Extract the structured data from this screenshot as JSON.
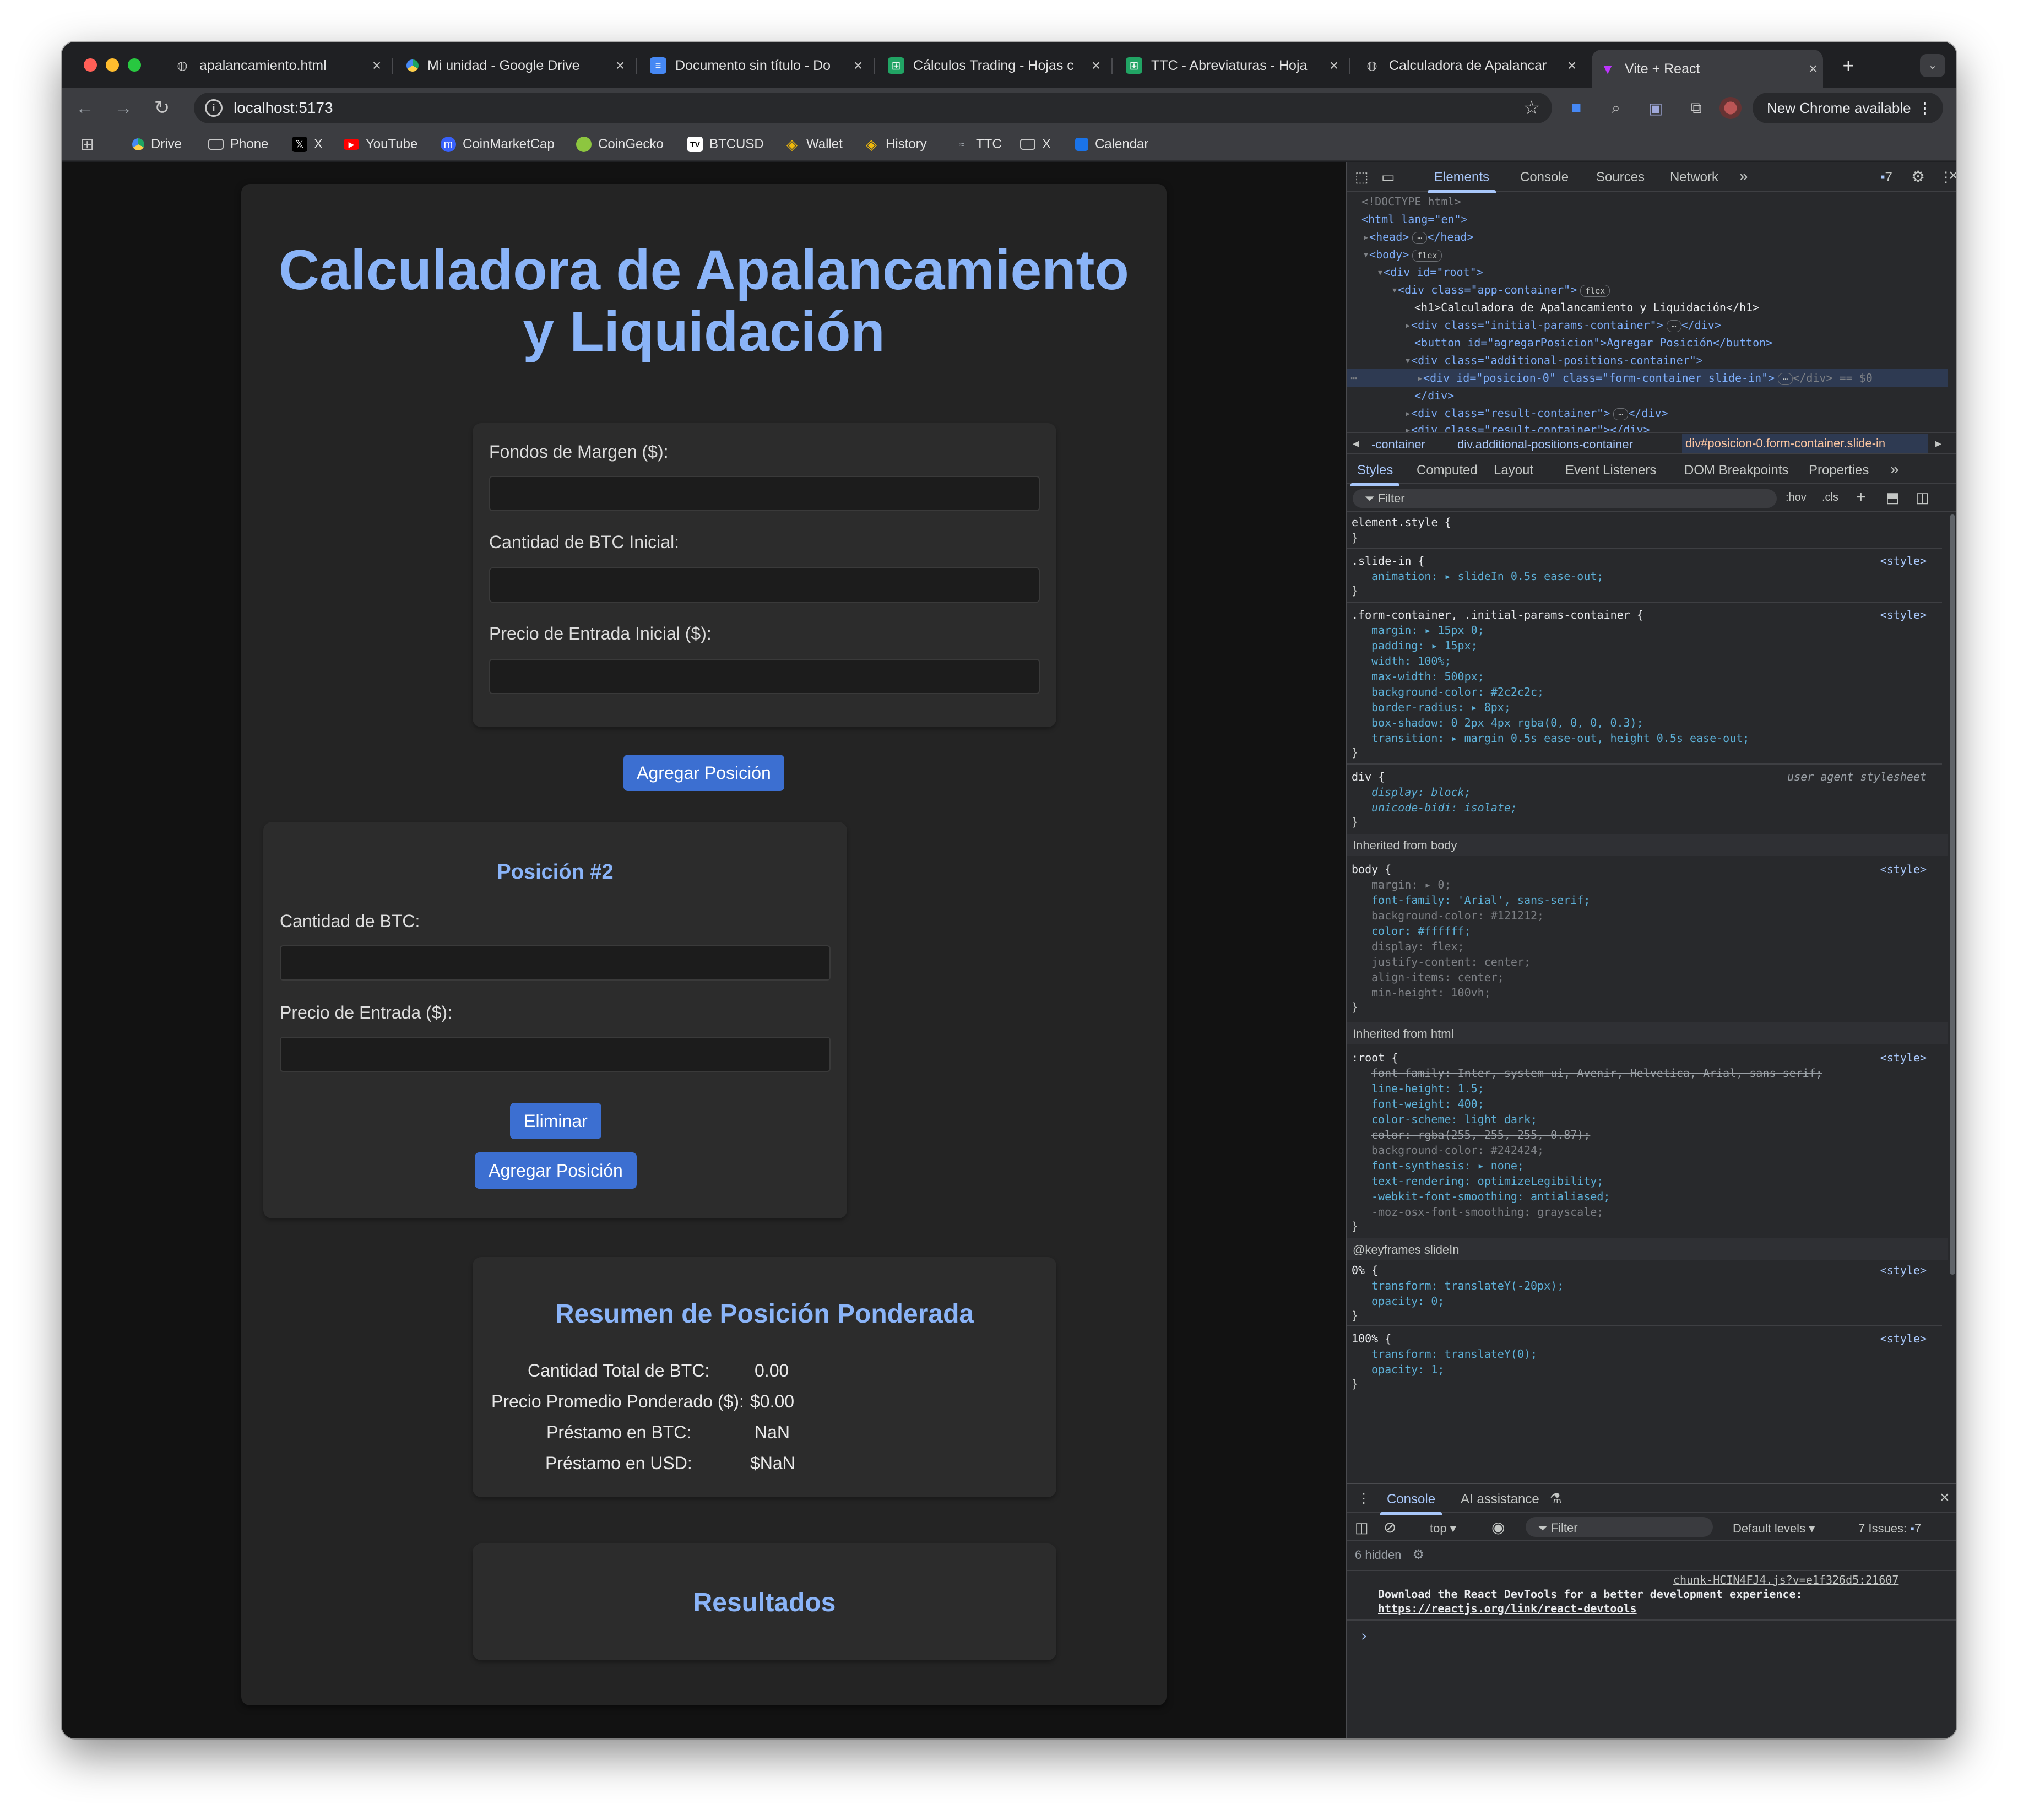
{
  "browser": {
    "tabs": [
      {
        "title": "apalancamiento.html",
        "icon": "globe-icon"
      },
      {
        "title": "Mi unidad - Google Drive",
        "icon": "drive-icon"
      },
      {
        "title": "Documento sin título - Do",
        "icon": "docs-icon"
      },
      {
        "title": "Cálculos Trading - Hojas c",
        "icon": "sheets-icon"
      },
      {
        "title": "TTC - Abreviaturas - Hoja",
        "icon": "sheets-icon"
      },
      {
        "title": "Calculadora de Apalancar",
        "icon": "globe-icon"
      },
      {
        "title": "Vite + React",
        "icon": "vite-icon",
        "active": true
      }
    ],
    "new_tab": "+",
    "url": "localhost:5173",
    "new_chrome": "New Chrome available",
    "bookmarks": [
      {
        "label": "Drive",
        "icon": "drive-icon"
      },
      {
        "label": "Phone",
        "icon": "folder-icon"
      },
      {
        "label": "X",
        "icon": "x-logo-icon"
      },
      {
        "label": "YouTube",
        "icon": "youtube-icon"
      },
      {
        "label": "CoinMarketCap",
        "icon": "coinmarketcap-icon"
      },
      {
        "label": "CoinGecko",
        "icon": "coingecko-icon"
      },
      {
        "label": "BTCUSD",
        "icon": "tradingview-icon"
      },
      {
        "label": "Wallet",
        "icon": "binance-icon"
      },
      {
        "label": "History",
        "icon": "binance-icon"
      },
      {
        "label": "TTC",
        "icon": "ttc-icon"
      },
      {
        "label": "X",
        "icon": "folder-icon"
      },
      {
        "label": "Calendar",
        "icon": "calendar-icon"
      }
    ]
  },
  "app": {
    "title": "Calculadora de Apalancamiento y Liquidación",
    "title_line1": "Calculadora de Apalancamiento",
    "title_line2": "y Liquidación",
    "initial": {
      "margin_label": "Fondos de Margen ($):",
      "btc_label": "Cantidad de BTC Inicial:",
      "price_label": "Precio de Entrada Inicial ($):"
    },
    "add_button": "Agregar Posición",
    "position": {
      "title": "Posición #2",
      "btc_label": "Cantidad de BTC:",
      "price_label": "Precio de Entrada ($):",
      "delete_button": "Eliminar",
      "add_button": "Agregar Posición"
    },
    "summary": {
      "title": "Resumen de Posición Ponderada",
      "rows": [
        {
          "label": "Cantidad Total de BTC:",
          "value": "0.00"
        },
        {
          "label": "Precio Promedio Ponderado ($):",
          "value": "$0.00"
        },
        {
          "label": "Préstamo en BTC:",
          "value": "NaN"
        },
        {
          "label": "Préstamo en USD:",
          "value": "$NaN"
        }
      ]
    },
    "results_title": "Resultados"
  },
  "devtools": {
    "tabs": [
      "Elements",
      "Console",
      "Sources",
      "Network"
    ],
    "issues_count": "7",
    "dom": {
      "doctype": "<!DOCTYPE html>",
      "html_open": "<html lang=\"en\">",
      "head": "<head>",
      "head_close": "</head>",
      "body": "<body>",
      "root": "<div id=\"root\">",
      "app_container": "<div class=\"app-container\">",
      "h1": "<h1>Calculadora de Apalancamiento y Liquidación</h1>",
      "initial_params": "<div class=\"initial-params-container\">",
      "div_close": "</div>",
      "button": "<button id=\"agregarPosicion\">Agregar Posición</button>",
      "additional": "<div class=\"additional-positions-container\">",
      "posicion": "<div id=\"posicion-0\" class=\"form-container slide-in\">",
      "posicion_tail": "</div> == $0",
      "result": "<div class=\"result-container\">",
      "result2": "<div class=\"result-container\"></div>",
      "flex_badge": "flex"
    },
    "breadcrumbs": [
      "-container",
      "div.additional-positions-container",
      "div#posicion-0.form-container.slide-in"
    ],
    "panel_tabs": [
      "Styles",
      "Computed",
      "Layout",
      "Event Listeners",
      "DOM Breakpoints",
      "Properties"
    ],
    "filter_placeholder": "Filter",
    "hov": ":hov",
    "cls": ".cls",
    "styles": {
      "element_style": "element.style {",
      "close": "}",
      "source": "<style>",
      "slide_in_sel": ".slide-in {",
      "slide_in_anim": "animation: ▸ slideIn 0.5s ease-out;",
      "fc_sel": ".form-container, .initial-params-container {",
      "fc_props": [
        "margin: ▸ 15px 0;",
        "padding: ▸ 15px;",
        "width: 100%;",
        "max-width: 500px;",
        "background-color: #2c2c2c;",
        "border-radius: ▸ 8px;",
        "box-shadow: 0 2px 4px rgba(0, 0, 0, 0.3);",
        "transition: ▸ margin 0.5s ease-out, height 0.5s ease-out;"
      ],
      "div_sel": "div {",
      "div_source": "user agent stylesheet",
      "div_props": [
        "display: block;",
        "unicode-bidi: isolate;"
      ],
      "inherited_body": "Inherited from body",
      "body_sel": "body {",
      "body_props": [
        {
          "t": "margin: ▸ 0;",
          "dim": true
        },
        {
          "t": "font-family: 'Arial', sans-serif;",
          "dim": false
        },
        {
          "t": "background-color: #121212;",
          "dim": true
        },
        {
          "t": "color: #ffffff;",
          "dim": false
        },
        {
          "t": "display: flex;",
          "dim": true
        },
        {
          "t": "justify-content: center;",
          "dim": true
        },
        {
          "t": "align-items: center;",
          "dim": true
        },
        {
          "t": "min-height: 100vh;",
          "dim": true
        }
      ],
      "inherited_html": "Inherited from html",
      "root_sel": ":root {",
      "root_props": [
        {
          "t": "font-family: Inter, system-ui, Avenir, Helvetica, Arial, sans-serif;",
          "s": "strike"
        },
        {
          "t": "line-height: 1.5;",
          "s": "normal"
        },
        {
          "t": "font-weight: 400;",
          "s": "normal"
        },
        {
          "t": "color-scheme: light dark;",
          "s": "normal"
        },
        {
          "t": "color: rgba(255, 255, 255, 0.87);",
          "s": "strike"
        },
        {
          "t": "background-color: #242424;",
          "s": "dim"
        },
        {
          "t": "font-synthesis: ▸ none;",
          "s": "normal"
        },
        {
          "t": "text-rendering: optimizeLegibility;",
          "s": "normal"
        },
        {
          "t": "-webkit-font-smoothing: antialiased;",
          "s": "normal"
        },
        {
          "t": "-moz-osx-font-smoothing: grayscale;",
          "s": "dim"
        }
      ],
      "keyframes": "@keyframes slideIn",
      "kf0_sel": "0% {",
      "kf0_props": [
        "transform: translateY(-20px);",
        "opacity: 0;"
      ],
      "kf100_sel": "100% {",
      "kf100_props": [
        "transform: translateY(0);",
        "opacity: 1;"
      ]
    },
    "console": {
      "tabs": [
        "Console",
        "AI assistance"
      ],
      "context": "top",
      "filter": "Filter",
      "levels": "Default levels",
      "issues": "7 Issues:",
      "issues_count": "7",
      "hidden": "6 hidden",
      "source_link": "chunk-HCIN4FJ4.js?v=e1f326d5:21607",
      "message": "Download the React DevTools for a better development experience:",
      "link": "https://reactjs.org/link/react-devtools",
      "prompt": "›"
    }
  },
  "colors": {
    "accent": "#8ab4f8",
    "button": "#3c6fd1",
    "page_bg": "#121212",
    "container_bg": "#242424",
    "card_bg": "#2c2c2c"
  }
}
